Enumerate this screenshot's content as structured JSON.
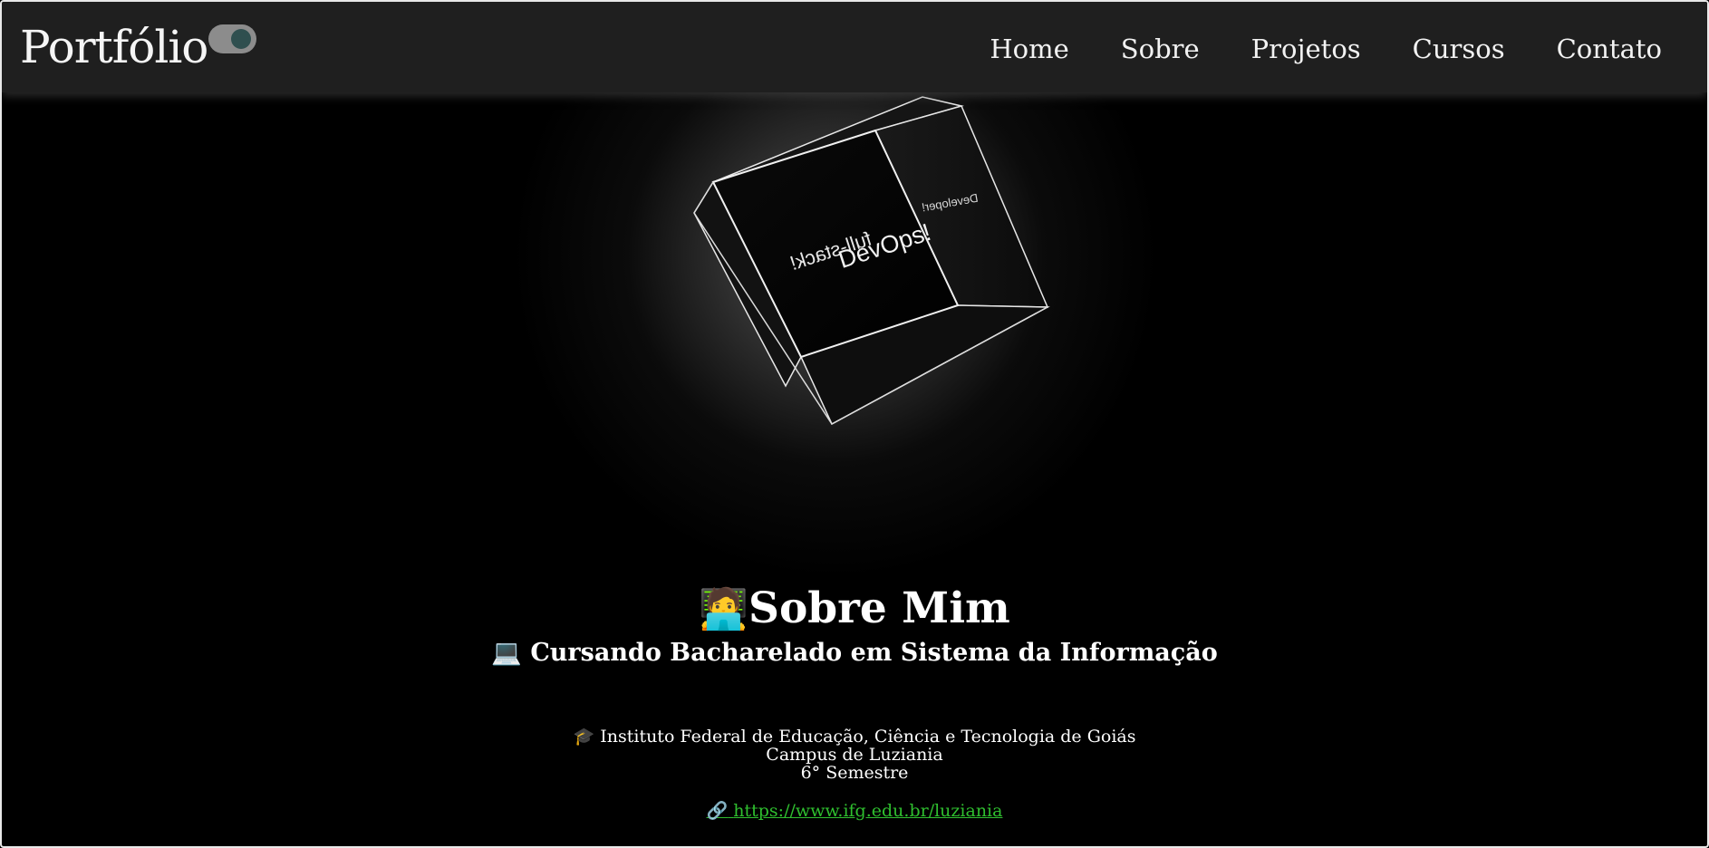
{
  "header": {
    "brand": "Portfólio",
    "theme_toggle": "toggle-icon",
    "nav": [
      {
        "label": "Home"
      },
      {
        "label": "Sobre"
      },
      {
        "label": "Projetos"
      },
      {
        "label": "Cursos"
      },
      {
        "label": "Contato"
      }
    ]
  },
  "cube": {
    "front_text_1": "full-stack!",
    "front_text_2": "DevOps!",
    "side_text": "Developer!"
  },
  "about": {
    "title_icon": "🧑‍💻",
    "title": "Sobre Mim",
    "subtitle_icon": "💻",
    "subtitle": "Cursando Bacharelado em Sistema da Informação",
    "institution_icon": "🎓",
    "institution": "Instituto Federal de Educação, Ciência e Tecnologia de Goiás",
    "campus": "Campus de Luziania",
    "semester": "6° Semestre",
    "link_icon": "🔗",
    "link": "https://www.ifg.edu.br/luziania"
  },
  "colors": {
    "navbar_bg": "#1f1f1f",
    "page_bg": "#000000",
    "text": "#ffffff",
    "link": "#2fbf2f"
  }
}
